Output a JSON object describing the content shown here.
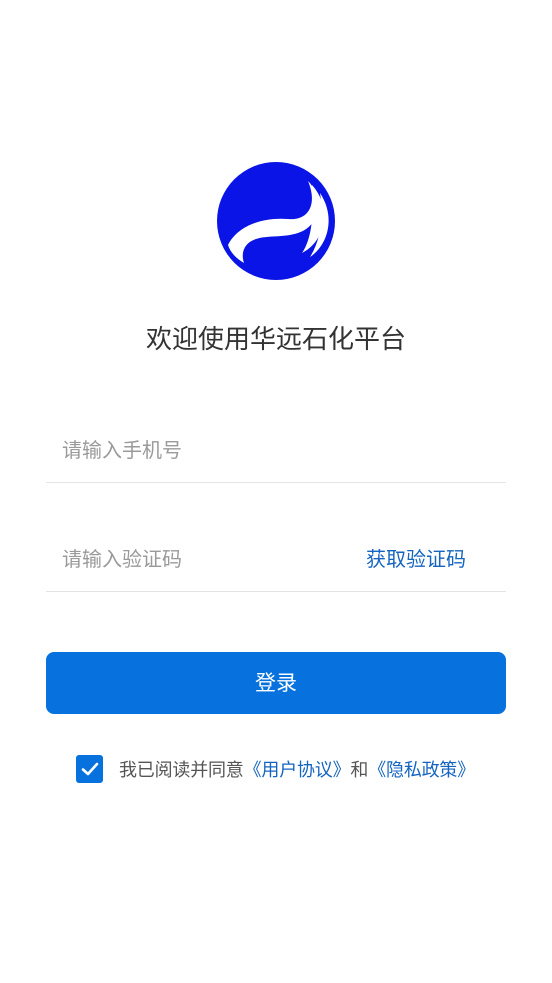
{
  "header": {
    "logo_icon": "huayuan-logo-icon",
    "title": "欢迎使用华远石化平台"
  },
  "form": {
    "phone_placeholder": "请输入手机号",
    "phone_value": "",
    "code_placeholder": "请输入验证码",
    "code_value": "",
    "get_code_label": "获取验证码",
    "login_label": "登录"
  },
  "agreement": {
    "checked": true,
    "prefix": "我已阅读并同意",
    "user_agreement": "《用户协议》",
    "and": "和",
    "privacy_policy": "《隐私政策》"
  },
  "colors": {
    "primary": "#0772de",
    "link": "#1565c0",
    "logo_blue": "#0a14e6"
  }
}
